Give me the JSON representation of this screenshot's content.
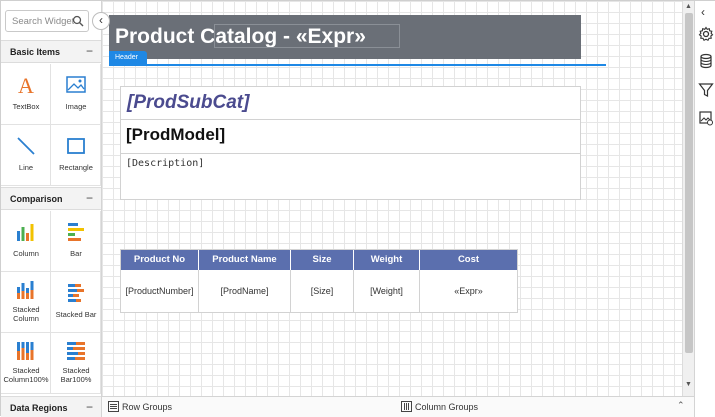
{
  "left_panel": {
    "search_placeholder": "Search Widgets",
    "sections": {
      "basic": {
        "title": "Basic Items",
        "toggle": "−"
      },
      "comparison": {
        "title": "Comparison",
        "toggle": "−"
      },
      "data_regions": {
        "title": "Data Regions",
        "toggle": "−"
      }
    },
    "basic_items": [
      {
        "label": "TextBox",
        "icon": "textbox-icon"
      },
      {
        "label": "Image",
        "icon": "image-icon"
      },
      {
        "label": "Line",
        "icon": "line-icon"
      },
      {
        "label": "Rectangle",
        "icon": "rectangle-icon"
      }
    ],
    "comparison_items": [
      {
        "label": "Column",
        "icon": "column-chart-icon"
      },
      {
        "label": "Bar",
        "icon": "bar-chart-icon"
      },
      {
        "label_line1": "Stacked",
        "label_line2": "Column",
        "icon": "stacked-column-icon"
      },
      {
        "label": "Stacked Bar",
        "icon": "stacked-bar-icon"
      },
      {
        "label_line1": "Stacked",
        "label_line2": "Column100%",
        "icon": "stacked-column100-icon"
      },
      {
        "label_line1": "Stacked",
        "label_line2": "Bar100%",
        "icon": "stacked-bar100-icon"
      }
    ]
  },
  "collapse_glyph": "‹",
  "report": {
    "title": "Product Catalog - «Expr»",
    "header_tag": "Header",
    "sub_category": "[ProdSubCat]",
    "model": "[ProdModel]",
    "description": "[Description]",
    "table": {
      "headers": [
        "Product No",
        "Product Name",
        "Size",
        "Weight",
        "Cost"
      ],
      "row": [
        "[ProductNumber]",
        "[ProdName]",
        "[Size]",
        "[Weight]",
        "«Expr»"
      ]
    }
  },
  "bottom_bar": {
    "row_groups": "Row Groups",
    "column_groups": "Column Groups",
    "expand_glyph": "⌃"
  },
  "right_toolbar": {
    "collapse_glyph": "‹",
    "icons": [
      "gear-icon",
      "database-icon",
      "filter-icon",
      "image-settings-icon"
    ]
  },
  "colors": {
    "header_band": "#6a6f77",
    "accent_blue": "#1e88e5",
    "table_header": "#5b6fae",
    "subcat_text": "#4b4b8f"
  }
}
